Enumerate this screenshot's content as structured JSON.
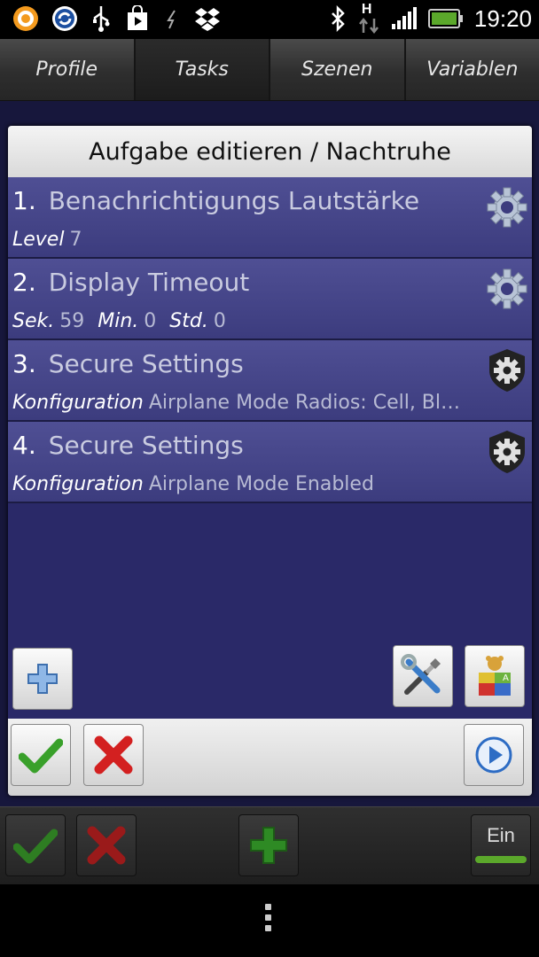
{
  "status_bar": {
    "time": "19:20",
    "icons": [
      "notification-app-icon",
      "sync-app-icon",
      "usb-icon",
      "play-store-icon",
      "sleep-icon",
      "dropbox-icon",
      "bluetooth-icon",
      "hspa-icon",
      "signal-icon",
      "battery-icon"
    ],
    "hspa_label": "H"
  },
  "tabs": [
    {
      "label": "Profile",
      "active": false
    },
    {
      "label": "Tasks",
      "active": true
    },
    {
      "label": "Szenen",
      "active": false
    },
    {
      "label": "Variablen",
      "active": false
    }
  ],
  "dialog": {
    "title": "Aufgabe editieren / Nachtruhe",
    "actions": [
      {
        "num": "1.",
        "name": "Benachrichtigungs Lautstärke",
        "params": [
          {
            "label": "Level",
            "value": "7"
          }
        ],
        "icon": "gear-icon"
      },
      {
        "num": "2.",
        "name": "Display Timeout",
        "params": [
          {
            "label": "Sek.",
            "value": "59"
          },
          {
            "label": "Min.",
            "value": "0"
          },
          {
            "label": "Std.",
            "value": "0"
          }
        ],
        "icon": "gear-icon"
      },
      {
        "num": "3.",
        "name": "Secure Settings",
        "params": [
          {
            "label": "Konfiguration",
            "value": "Airplane Mode Radios: Cell, Bl…"
          }
        ],
        "icon": "plugin-gear-icon"
      },
      {
        "num": "4.",
        "name": "Secure Settings",
        "params": [
          {
            "label": "Konfiguration",
            "value": "Airplane Mode Enabled"
          }
        ],
        "icon": "plugin-gear-icon"
      }
    ],
    "buttons": {
      "add": "plus-icon",
      "settings": "tools-icon",
      "icon_select": "toy-icon",
      "accept": "checkmark-icon",
      "cancel": "cross-icon",
      "play": "play-icon"
    }
  },
  "bottom_bar": {
    "toggle_label": "Ein"
  },
  "colors": {
    "accent_green": "#5ba82b",
    "cancel_red": "#d32020",
    "dialog_bg": "#2a2968",
    "action_bg": "#46468a"
  }
}
